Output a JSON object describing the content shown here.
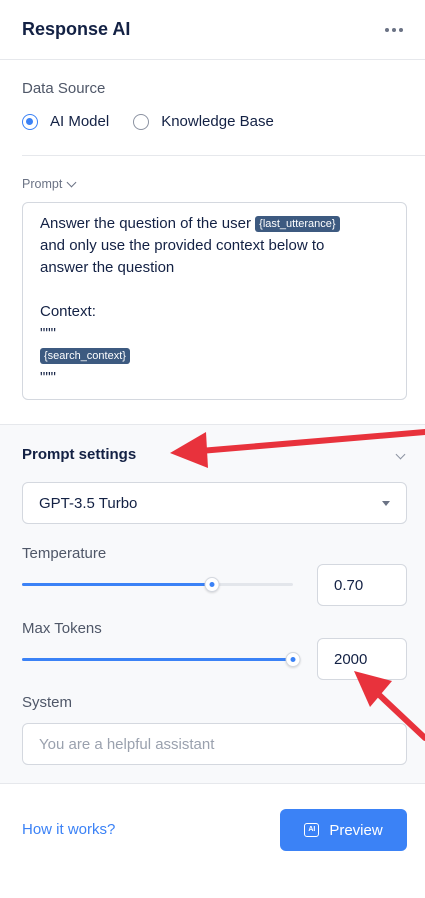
{
  "header": {
    "title": "Response AI",
    "menu_icon": "more-horizontal-icon"
  },
  "data_source": {
    "label": "Data Source",
    "options": [
      {
        "label": "AI Model",
        "checked": true
      },
      {
        "label": "Knowledge Base",
        "checked": false
      }
    ]
  },
  "prompt": {
    "label": "Prompt",
    "lines": [
      {
        "text": "Answer the question of the user ",
        "var": "{last_utterance}"
      },
      {
        "text": "and only use the provided context below to"
      },
      {
        "text": "answer the question"
      },
      {
        "text": ""
      },
      {
        "text": "Context:"
      },
      {
        "text": "\"\"\""
      },
      {
        "text": "",
        "var": "{search_context}"
      },
      {
        "text": "\"\"\""
      }
    ]
  },
  "prompt_settings": {
    "title": "Prompt settings",
    "model": "GPT-3.5 Turbo",
    "temperature": {
      "label": "Temperature",
      "value": "0.70",
      "slider_fraction": 0.7
    },
    "max_tokens": {
      "label": "Max Tokens",
      "value": "2000",
      "slider_fraction": 1.0
    },
    "system": {
      "label": "System",
      "placeholder": "You are a helpful assistant",
      "value": ""
    }
  },
  "footer": {
    "help_link": "How it works?",
    "preview_label": "Preview",
    "preview_icon": "ai-icon"
  },
  "colors": {
    "accent": "#3b82f6",
    "annotation_arrow": "#e8323c",
    "variable_chip": "#3d5a80"
  }
}
